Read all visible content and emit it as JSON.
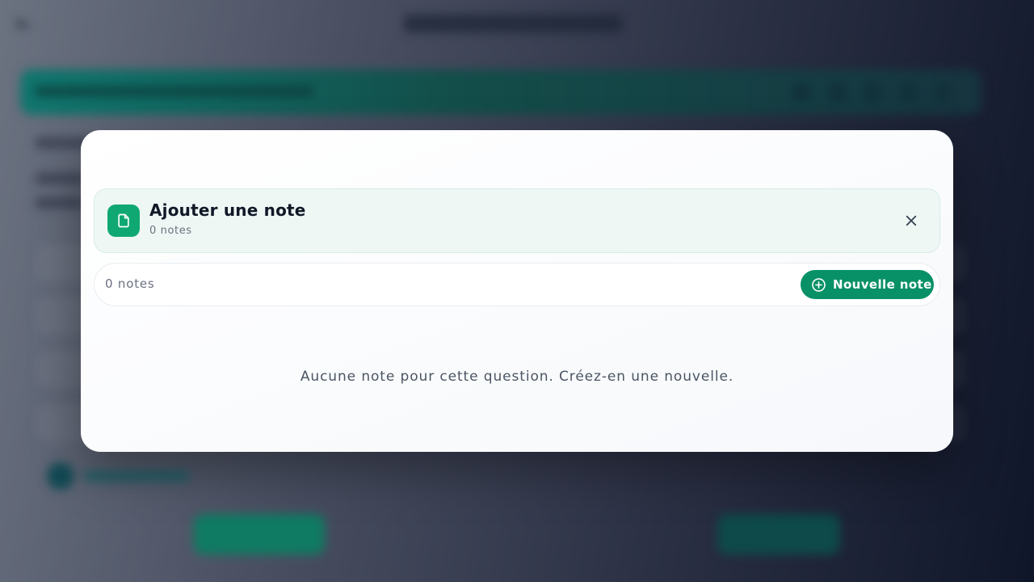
{
  "modal": {
    "title": "Ajouter une note",
    "subtitle": "0 notes",
    "toolbar": {
      "count_label": "0 notes",
      "new_note_label": "Nouvelle note"
    },
    "empty_message": "Aucune note pour cette question. Créez-en une nouvelle.",
    "icons": {
      "header": "document-icon",
      "close": "close-icon",
      "new_note": "plus-circle-icon"
    }
  },
  "colors": {
    "accent": "#10a872",
    "button": "#089166",
    "header_bg": "#eef7f4"
  }
}
